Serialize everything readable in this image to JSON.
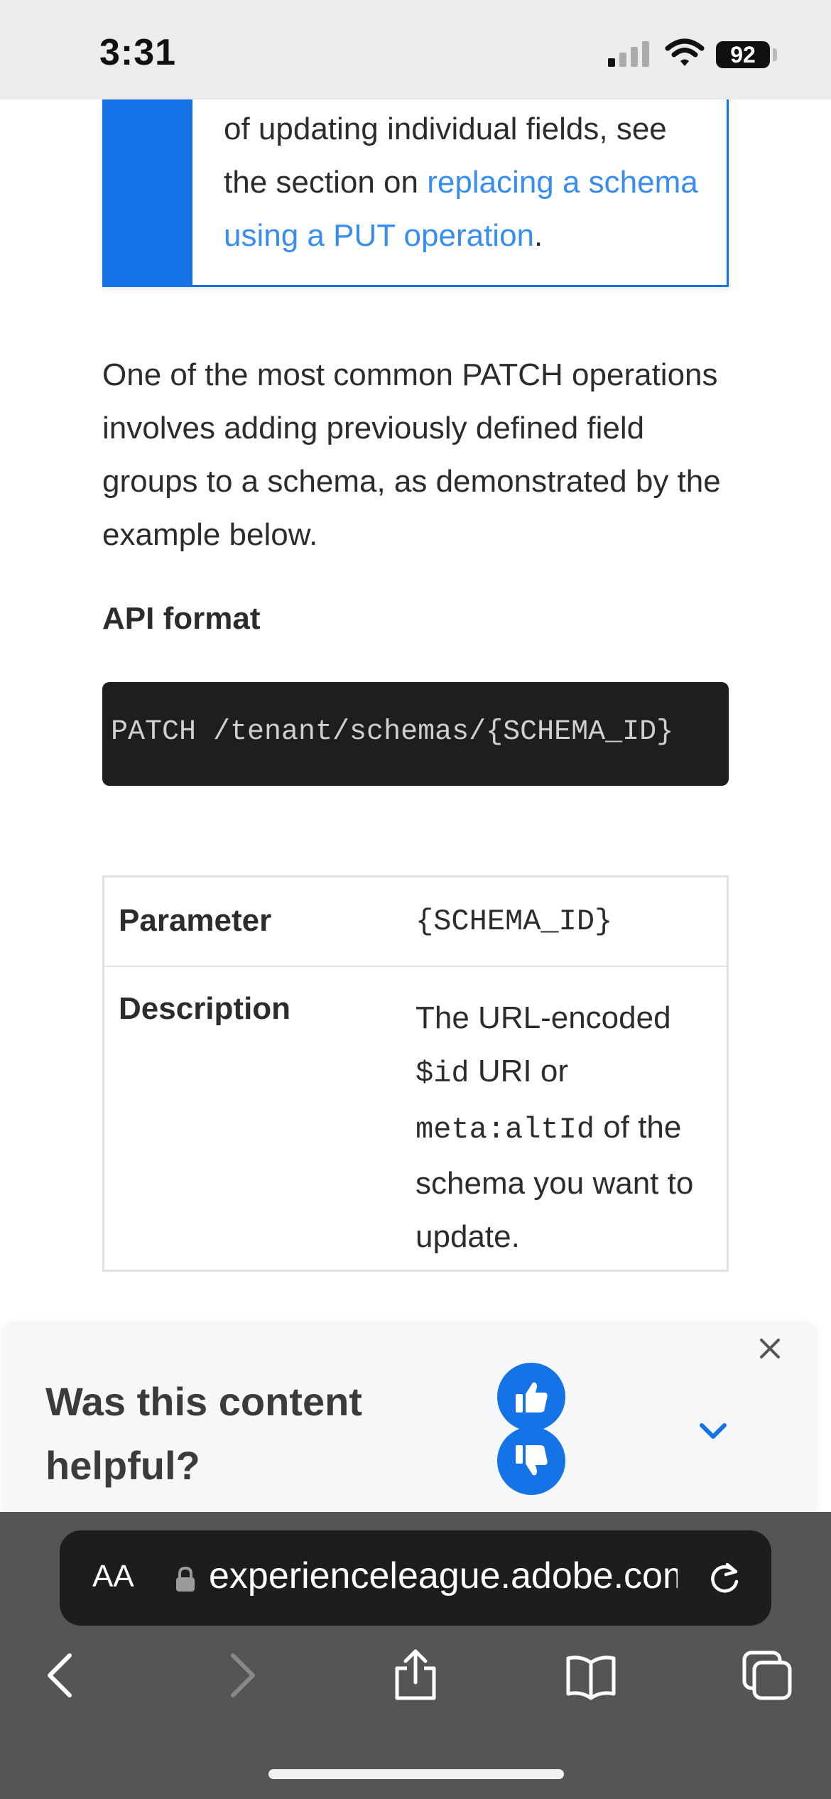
{
  "status_bar": {
    "time": "3:31",
    "battery": "92"
  },
  "note": {
    "text_before": "of updating individual fields, see the section on ",
    "link_text": "replacing a schema using a PUT operation",
    "text_after": "."
  },
  "intro_paragraph": "One of the most common PATCH operations involves adding previously defined field groups to a schema, as demonstrated by the example below.",
  "api_format": {
    "heading": "API format",
    "code": "PATCH /tenant/schemas/{SCHEMA_ID}"
  },
  "param_table": {
    "rows": [
      {
        "header": "Parameter",
        "value": "{SCHEMA_ID}"
      },
      {
        "header": "Description",
        "desc_part1": "The URL-encoded ",
        "desc_code1": "$id",
        "desc_part2": " URI or ",
        "desc_code2": "meta:altId",
        "desc_part3": " of the schema you want to update."
      }
    ]
  },
  "feedback": {
    "question": "Was this content helpful?"
  },
  "browser": {
    "aa_label": "AA",
    "url": "experienceleague.adobe.com"
  },
  "colors": {
    "accent": "#1473e6",
    "link": "#378ef0",
    "code_bg": "#1e1e1e"
  },
  "icons": [
    "signal-icon",
    "wifi-icon",
    "thumbs-up-icon",
    "thumbs-down-icon",
    "chevron-down-icon",
    "close-icon",
    "lock-icon",
    "reload-icon",
    "back-icon",
    "forward-icon",
    "share-icon",
    "bookmarks-icon",
    "tabs-icon"
  ]
}
